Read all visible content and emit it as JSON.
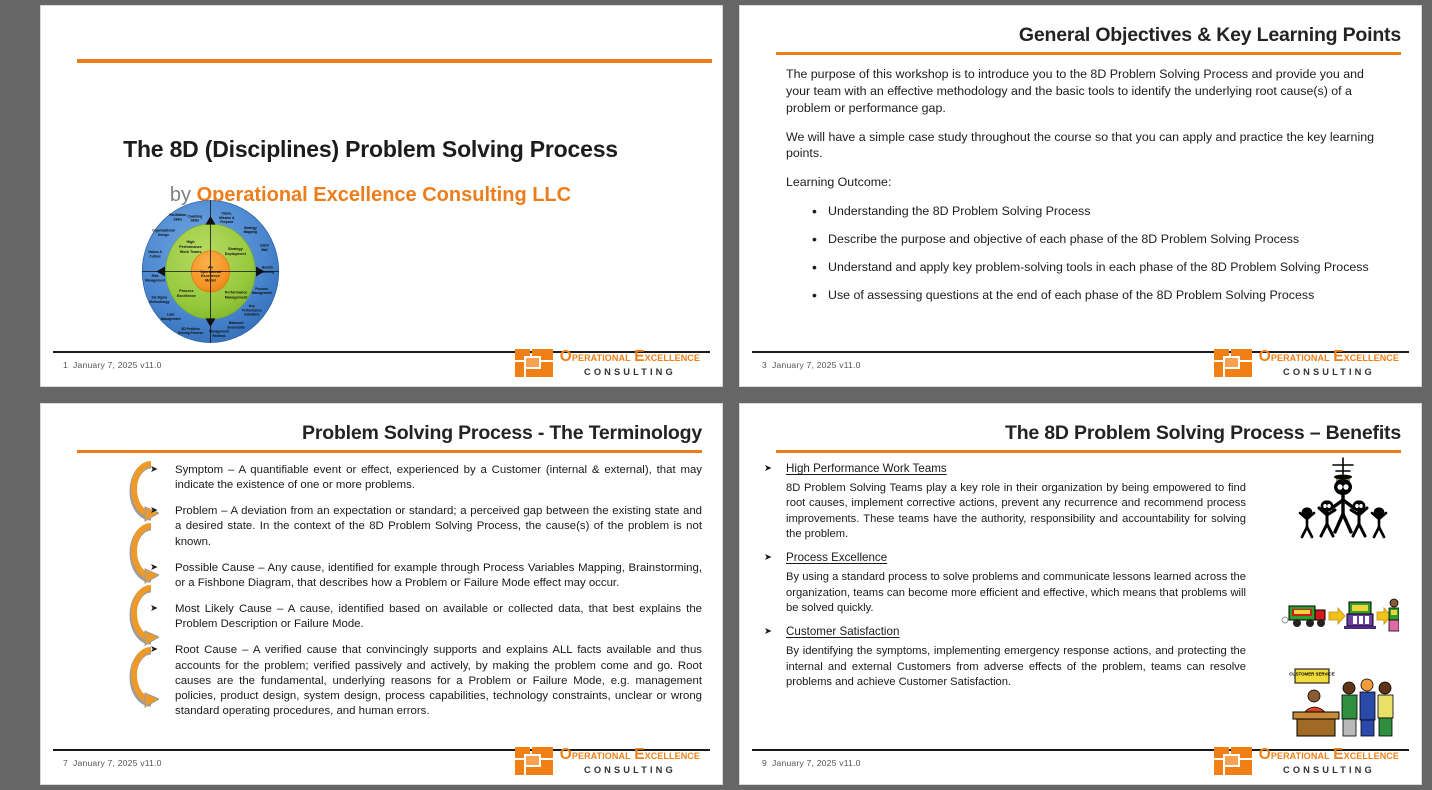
{
  "brand": {
    "accent_orange": "#ED7D1B",
    "logo_orange": "#F07F16",
    "background_gray": "#666666",
    "logo_line1_a": "O",
    "logo_line1_b": "perational ",
    "logo_line1_c": "E",
    "logo_line1_d": "xcellence",
    "logo_line2": "CONSULTING"
  },
  "slides": [
    {
      "id": "slide-title",
      "page_number": "1",
      "date": "January 7, 2025",
      "version": "v11.0",
      "title": "The 8D (Disciplines) Problem Solving Process",
      "byline_prefix": "by ",
      "byline_company": "Operational Excellence Consulting LLC",
      "wheel": {
        "center": "An Operational Excellence Model",
        "inner_ring": [
          "High Performance Work Teams",
          "Strategy Deployment",
          "Performance Management",
          "Process Excellence"
        ],
        "outer_ring": [
          "Coaching Skills",
          "Vision, Mission & Purpose",
          "Strategy Mapping",
          "Catch Ball",
          "Hoshin Planning",
          "Process Management",
          "Key Performance Indicators",
          "Balanced Scorecards",
          "Management Reviews",
          "8D Problem Solving Process",
          "Lean Management",
          "Six Sigma Methodology",
          "Risk Management",
          "Values & Culture",
          "Organizational Design",
          "Facilitation Skills"
        ]
      }
    },
    {
      "id": "slide-objectives",
      "page_number": "3",
      "date": "January 7, 2025",
      "version": "v11.0",
      "title": "General Objectives & Key Learning Points",
      "paragraphs": [
        "The purpose of this workshop is to introduce you to the 8D Problem Solving Process and provide you and your team with an effective methodology and the basic tools to identify the underlying root cause(s) of a problem or performance gap.",
        "We will have a simple case study throughout the course so that you can apply and practice the key learning points.",
        "Learning Outcome:"
      ],
      "bullets": [
        "Understanding the 8D Problem Solving Process",
        "Describe the purpose and objective of each phase of the 8D Problem Solving Process",
        "Understand and apply key problem-solving tools in each phase of the 8D Problem Solving Process",
        "Use of assessing questions at the end of each phase of the 8D Problem Solving Process"
      ]
    },
    {
      "id": "slide-terminology",
      "page_number": "7",
      "date": "January 7, 2025",
      "version": "v11.0",
      "title": "Problem Solving Process - The Terminology",
      "terms": [
        "Symptom – A quantifiable event or effect, experienced by a Customer (internal & external), that may indicate the existence of one or more problems.",
        "Problem – A deviation from an expectation or standard; a perceived gap between the existing state and a desired state. In the context of the 8D Problem Solving Process, the cause(s) of the problem is not known.",
        "Possible Cause – Any cause, identified for example through Process Variables Mapping, Brainstorming, or a Fishbone Diagram, that describes how a Problem or Failure Mode effect may occur.",
        "Most Likely Cause – A cause, identified based on available or collected data, that best explains the Problem Description or Failure Mode.",
        "Root Cause – A verified cause that convincingly supports and explains ALL facts available and thus accounts for the problem; verified passively and actively, by making the problem come and go. Root causes are the fundamental, underlying reasons for a Problem or Failure Mode, e.g. management policies, product design, system design, process capabilities, technology constraints, unclear or wrong standard operating procedures, and human errors."
      ]
    },
    {
      "id": "slide-benefits",
      "page_number": "9",
      "date": "January 7, 2025",
      "version": "v11.0",
      "title": "The 8D Problem Solving Process – Benefits",
      "benefits": [
        {
          "heading": "High Performance Work Teams",
          "body": "8D Problem Solving Teams play a key role in their organization by being empowered to find root causes, implement corrective actions, prevent any recurrence and recommend process improvements. These teams have the authority, responsibility and accountability for solving the problem.",
          "art": "celebrating-team-trophy-clipart"
        },
        {
          "heading": "Process Excellence",
          "body": "By using a standard process to solve problems and communicate lessons learned across the organization, teams can become more efficient and effective, which means that problems will be solved quickly.",
          "art": "process-flow-truck-machine-person-clipart"
        },
        {
          "heading": "Customer Satisfaction",
          "body": "By identifying the symptoms, implementing emergency response actions, and protecting the internal and external Customers from adverse effects of the problem, teams can resolve problems and achieve Customer Satisfaction.",
          "art": "customer-service-desk-queue-clipart",
          "art_label": "CUSTOMER SERVICE"
        }
      ]
    }
  ]
}
